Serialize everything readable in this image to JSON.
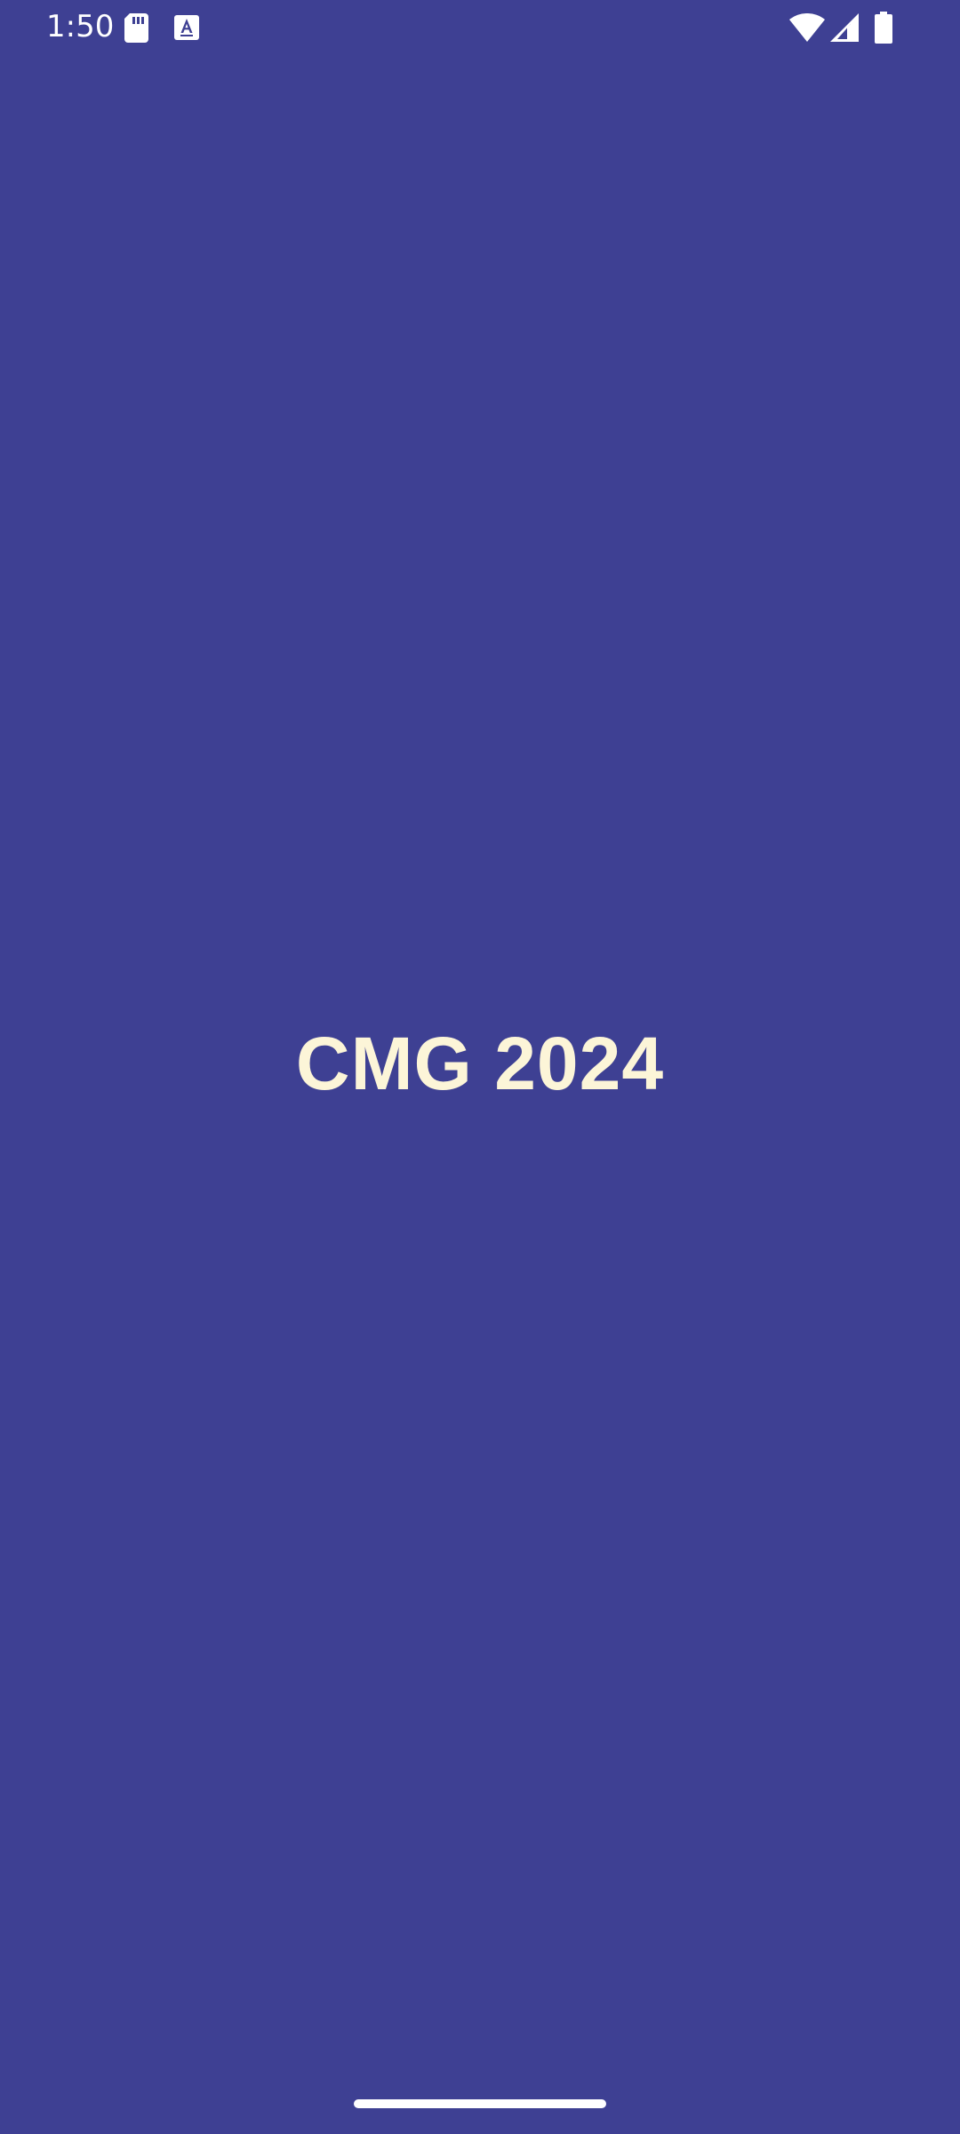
{
  "status_bar": {
    "time": "1:50",
    "icons": [
      "sd-card-icon",
      "keyboard-a-icon",
      "wifi-icon",
      "cell-signal-icon",
      "battery-icon"
    ]
  },
  "splash": {
    "title": "CMG 2024"
  },
  "colors": {
    "background": "#3e4093",
    "title": "#fcf5d8",
    "status_icons": "#ffffff"
  }
}
